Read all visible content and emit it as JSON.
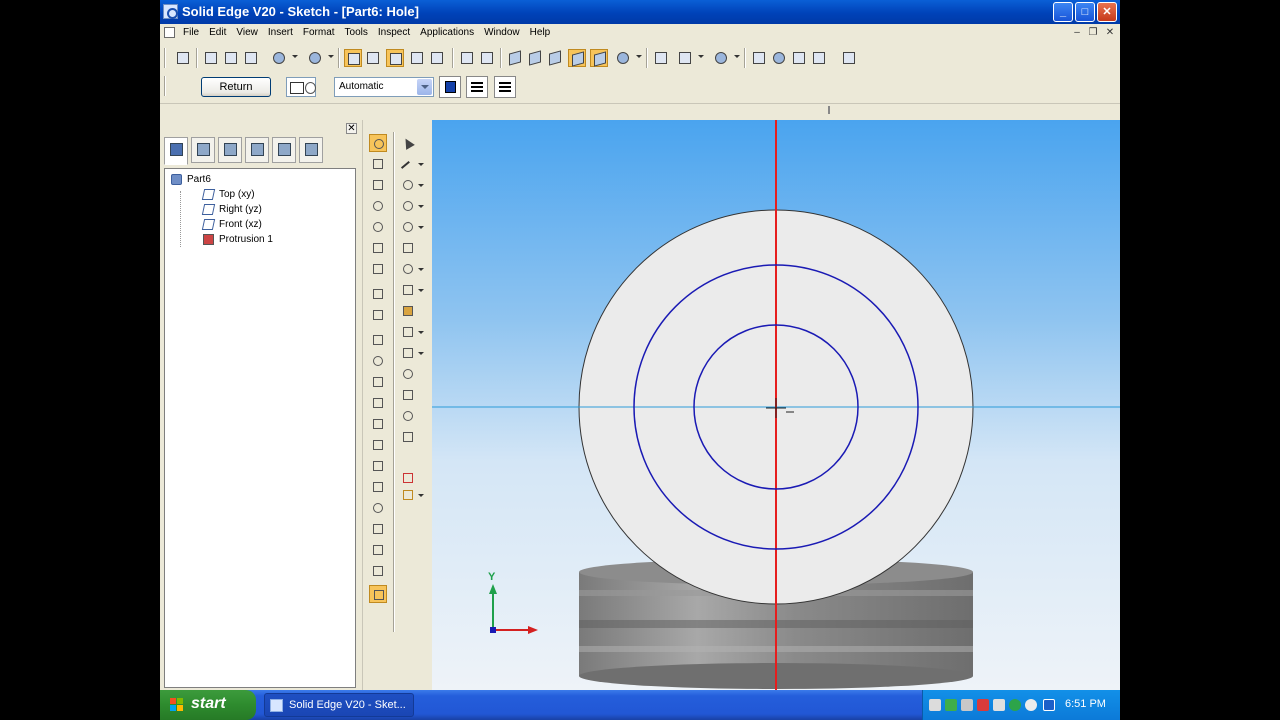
{
  "window": {
    "title": "Solid Edge V20 - Sketch - [Part6: Hole]"
  },
  "menu": {
    "items": [
      "File",
      "Edit",
      "View",
      "Insert",
      "Format",
      "Tools",
      "Inspect",
      "Applications",
      "Window",
      "Help"
    ]
  },
  "toolbar2": {
    "return_label": "Return",
    "mode_value": "Automatic"
  },
  "pathfinder": {
    "tree": [
      {
        "label": "Part6",
        "icon": "part-icon"
      },
      {
        "label": "Top (xy)",
        "icon": "plane-icon"
      },
      {
        "label": "Right (yz)",
        "icon": "plane-icon"
      },
      {
        "label": "Front (xz)",
        "icon": "plane-icon"
      },
      {
        "label": "Protrusion 1",
        "icon": "protrusion-icon"
      }
    ]
  },
  "canvas": {
    "axis_y_label": "Y",
    "colors": {
      "background_top": "#4aa4ef",
      "background_bottom": "#e6eef7",
      "face": "#e8e8e8",
      "circle": "#1a1ab4",
      "vertical_ref": "#e61e1e",
      "horizontal_ref": "#2c9bd8"
    }
  },
  "taskbar": {
    "start_label": "start",
    "task_label": "Solid Edge V20 - Sket...",
    "clock": "6:51 PM"
  }
}
